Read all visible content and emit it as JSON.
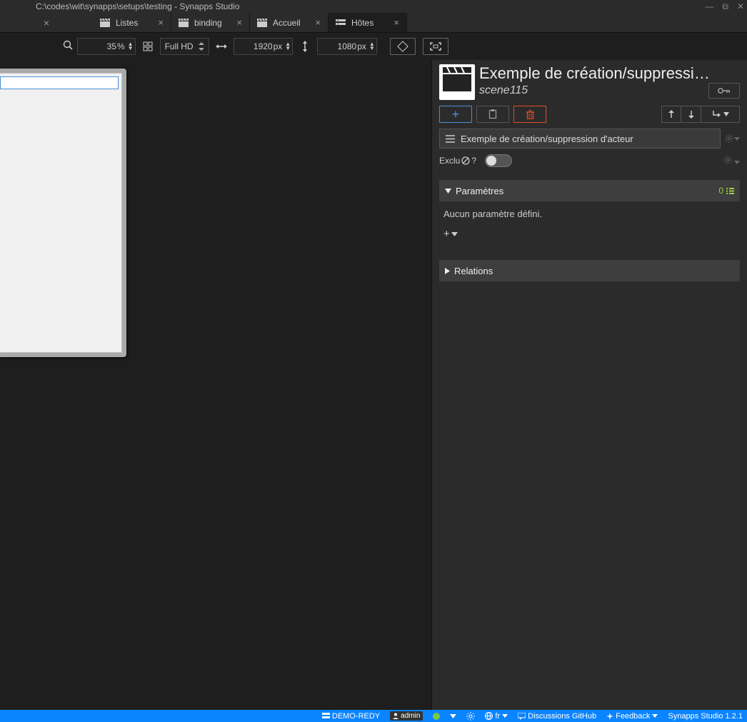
{
  "window": {
    "title": "C:\\codes\\wit\\synapps\\setups\\testing - Synapps Studio"
  },
  "tabs": [
    {
      "label": "Listes",
      "icon": "clapper"
    },
    {
      "label": "binding",
      "icon": "clapper"
    },
    {
      "label": "Accueil",
      "icon": "clapper"
    },
    {
      "label": "Hôtes",
      "icon": "hosts",
      "active": true
    }
  ],
  "toolbar": {
    "zoom": "35",
    "zoom_unit": "%",
    "resolution_label": "Full HD",
    "width": "1920",
    "height": "1080",
    "px": "px"
  },
  "inspector": {
    "title": "Exemple de création/suppressi…",
    "scene_key": "scene115",
    "name_field": "Exemple de création/suppression d'acteur",
    "exclu_label": "Exclu",
    "exclu_q": "?",
    "sections": {
      "params": {
        "title": "Paramètres",
        "count": "0",
        "empty": "Aucun paramètre défini."
      },
      "relations": {
        "title": "Relations"
      }
    }
  },
  "status": {
    "host": "DEMO-REDY",
    "user": "admin",
    "lang": "fr",
    "discussions": "Discussions GitHub",
    "feedback": "Feedback",
    "version": "Synapps Studio 1.2.1"
  }
}
